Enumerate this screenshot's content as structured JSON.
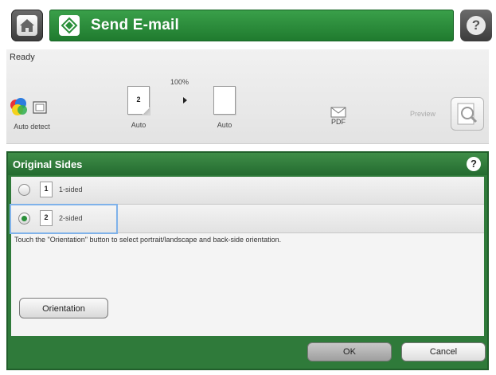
{
  "header": {
    "title": "Send E-mail",
    "home_icon": "home-icon",
    "app_icon": "email-app-icon",
    "help_icon": "help-icon",
    "help_glyph": "?"
  },
  "status": {
    "text": "Ready"
  },
  "options": {
    "color": {
      "label": "Auto detect",
      "icon": "color-detect-icon"
    },
    "original": {
      "label": "Auto",
      "page_number": "2"
    },
    "zoom": {
      "value": "100%"
    },
    "output": {
      "label": "Auto"
    },
    "file_type": {
      "label": "PDF",
      "icon": "pdf-file-icon"
    },
    "preview": {
      "label": "Preview",
      "icon": "magnifier-icon"
    }
  },
  "panel": {
    "title": "Original Sides",
    "help_glyph": "?",
    "options": [
      {
        "number": "1",
        "label": "1-sided",
        "selected": false
      },
      {
        "number": "2",
        "label": "2-sided",
        "selected": true
      }
    ],
    "hint": "Touch the \"Orientation\" button to select portrait/landscape and back-side orientation.",
    "orientation_label": "Orientation"
  },
  "footer": {
    "ok_label": "OK",
    "cancel_label": "Cancel"
  },
  "colors": {
    "title_green": "#2a8f3a",
    "panel_green": "#2f7a3a",
    "selection_blue": "#7fb2ea"
  }
}
